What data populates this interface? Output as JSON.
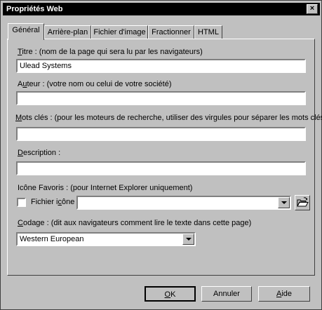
{
  "window": {
    "title": "Propriétés Web"
  },
  "tabs": [
    {
      "label": "Général",
      "active": true
    },
    {
      "label": "Arrière-plan",
      "active": false
    },
    {
      "label": "Fichier d'image",
      "active": false
    },
    {
      "label": "Fractionner",
      "active": false
    },
    {
      "label": "HTML",
      "active": false
    }
  ],
  "form": {
    "title": {
      "label_key": "T",
      "label_rest": "itre : (nom de la page qui sera lu par les navigateurs)",
      "value": "Ulead Systems"
    },
    "author": {
      "label_pre": "A",
      "label_key": "u",
      "label_rest": "teur : (votre nom ou celui de votre société)",
      "value": ""
    },
    "keywords": {
      "label_key": "M",
      "label_rest": "ots clés : (pour les moteurs de recherche, utiliser des virgules pour séparer les mots clés)",
      "value": ""
    },
    "description": {
      "label_key": "D",
      "label_rest": "escription :",
      "value": ""
    },
    "favicon": {
      "label": "Icône Favoris : (pour Internet Explorer uniquement)",
      "checkbox_label_pre": "Fichier i",
      "checkbox_label_key": "c",
      "checkbox_label_rest": "ône",
      "checked": false,
      "value": ""
    },
    "encoding": {
      "label_key": "C",
      "label_rest": "odage : (dit aux navigateurs comment lire le texte dans cette page)",
      "value": "Western European"
    }
  },
  "buttons": {
    "ok_key": "O",
    "ok_rest": "K",
    "cancel": "Annuler",
    "help_key": "A",
    "help_rest": "ide"
  },
  "icons": {
    "close": "close-icon",
    "folder": "folder-open-icon",
    "dropdown": "chevron-down-icon"
  }
}
